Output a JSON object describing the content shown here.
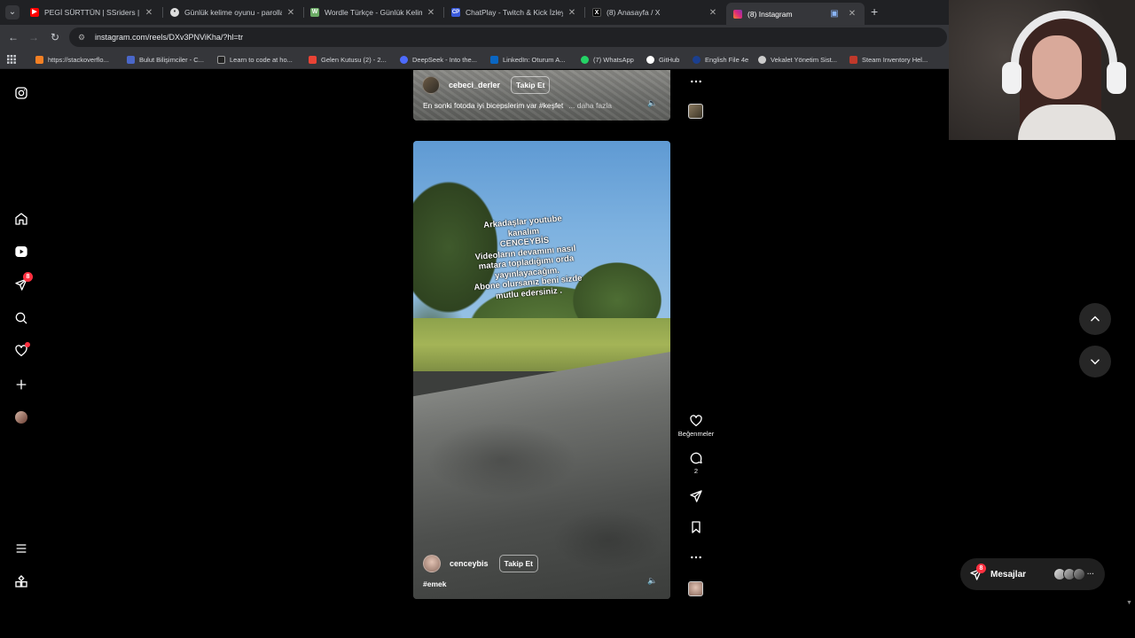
{
  "browser": {
    "tabs": [
      {
        "title": "PEGİ SÜRTTÜN | SSriders | Moto",
        "color": "#ff0000"
      },
      {
        "title": "Günlük kelime oyunu - parolla",
        "color": "#dddddd"
      },
      {
        "title": "Wordle Türkçe - Günlük Kelime",
        "color": "#6aaa64"
      },
      {
        "title": "ChatPlay - Twitch & Kick İzleyici",
        "color": "#3b5bdb"
      },
      {
        "title": "(8) Anasayfa / X",
        "color": "#000000"
      },
      {
        "title": "(8) Instagram",
        "color": "#d6249f"
      }
    ],
    "url": "instagram.com/reels/DXv3PNViKha/?hl=tr",
    "bookmarks": [
      {
        "label": "https://stackoverflo...",
        "color": "#f48024"
      },
      {
        "label": "Bulut Bilişimciler - C...",
        "color": "#4a67c9"
      },
      {
        "label": "Learn to code at ho...",
        "color": "#222222"
      },
      {
        "label": "Gelen Kutusu (2) - 2...",
        "color": "#ea4335"
      },
      {
        "label": "DeepSeek - Into the...",
        "color": "#4d6bfe"
      },
      {
        "label": "LinkedIn: Oturum A...",
        "color": "#0a66c2"
      },
      {
        "label": "(7) WhatsApp",
        "color": "#25d366"
      },
      {
        "label": "GitHub",
        "color": "#ffffff"
      },
      {
        "label": "English File 4e",
        "color": "#1b3f8f"
      },
      {
        "label": "Vekalet Yönetim Sist...",
        "color": "#cccccc"
      },
      {
        "label": "Steam Inventory Hel...",
        "color": "#c0392b"
      }
    ]
  },
  "sidebar": {
    "notification_badge": "8"
  },
  "reel_previous": {
    "username": "cebeci_derler",
    "follow_label": "Takip Et",
    "caption": "En sonki fotoda iyi bicepslerim var #keşfet",
    "more_label": "... daha fazla"
  },
  "reel_current": {
    "overlay_lines": [
      "Arkadaşlar youtube",
      "kanalım",
      "CENCEYBİS",
      "Videoların devamını nasıl",
      "matara topladığımı orda",
      "yayınlayacağım.",
      "Abone olursanız beni sizde",
      "mutlu edersiniz ."
    ],
    "username": "cenceybis",
    "follow_label": "Takip Et",
    "caption": "#emek"
  },
  "actions": {
    "like_label": "Beğenmeler",
    "comment_count": "2"
  },
  "messages": {
    "label": "Mesajlar",
    "badge": "8"
  }
}
